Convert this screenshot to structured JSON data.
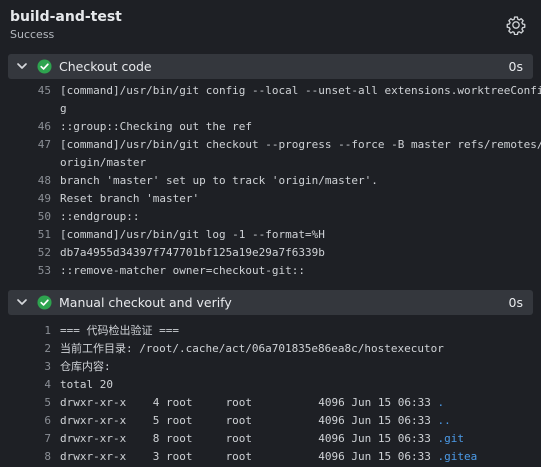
{
  "job": {
    "title": "build-and-test",
    "status": "Success",
    "settings_icon": "gear-icon"
  },
  "steps": [
    {
      "name": "Checkout code",
      "duration": "0s",
      "status": "success",
      "lines": [
        {
          "num": "45",
          "text": "[command]/usr/bin/git config --local --unset-all extensions.worktreeConfi"
        },
        {
          "num": "",
          "text": "g"
        },
        {
          "num": "46",
          "text": "::group::Checking out the ref"
        },
        {
          "num": "47",
          "text": "[command]/usr/bin/git checkout --progress --force -B master refs/remotes/"
        },
        {
          "num": "",
          "text": "origin/master"
        },
        {
          "num": "48",
          "text": "branch 'master' set up to track 'origin/master'."
        },
        {
          "num": "49",
          "text": "Reset branch 'master'"
        },
        {
          "num": "50",
          "text": "::endgroup::"
        },
        {
          "num": "51",
          "text": "[command]/usr/bin/git log -1 --format=%H"
        },
        {
          "num": "52",
          "text": "db7a4955d34397f747701bf125a19e29a7f6339b"
        },
        {
          "num": "53",
          "text": "::remove-matcher owner=checkout-git::"
        }
      ]
    },
    {
      "name": "Manual checkout and verify",
      "duration": "0s",
      "status": "success",
      "lines": [
        {
          "num": "1",
          "text": "=== 代码检出验证 ==="
        },
        {
          "num": "2",
          "text": "当前工作目录: /root/.cache/act/06a701835e86ea8c/hostexecutor"
        },
        {
          "num": "3",
          "text": "仓库内容:"
        },
        {
          "num": "4",
          "text": "total 20"
        },
        {
          "num": "5",
          "text": "drwxr-xr-x    4 root     root          4096 Jun 15 06:33 ",
          "highlight": "."
        },
        {
          "num": "6",
          "text": "drwxr-xr-x    5 root     root          4096 Jun 15 06:33 ",
          "highlight": ".."
        },
        {
          "num": "7",
          "text": "drwxr-xr-x    8 root     root          4096 Jun 15 06:33 ",
          "highlight": ".git"
        },
        {
          "num": "8",
          "text": "drwxr-xr-x    3 root     root          4096 Jun 15 06:33 ",
          "highlight": ".gitea"
        }
      ]
    }
  ],
  "colors": {
    "background": "#1e2025",
    "step_header": "#34373d",
    "success": "#2ea44f",
    "dir_highlight": "#4c9be8"
  }
}
